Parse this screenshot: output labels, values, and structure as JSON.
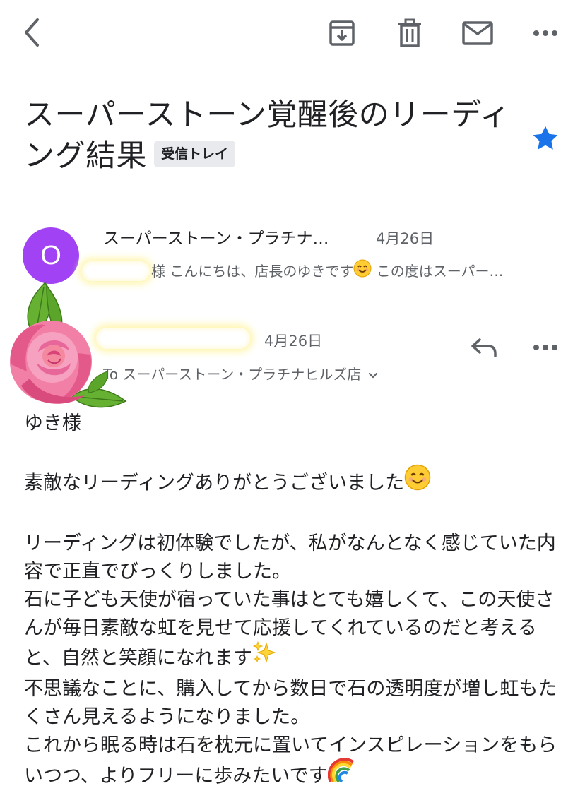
{
  "toolbar": {
    "back_icon": "chevron-left-icon",
    "archive_icon": "archive-icon",
    "delete_icon": "trash-icon",
    "mark_unread_icon": "mail-icon",
    "more_icon": "more-horizontal-icon"
  },
  "subject": {
    "title": "スーパーストーン覚醒後のリーディング結果",
    "label": "受信トレイ",
    "starred": true,
    "star_color": "#1a73e8"
  },
  "messages": [
    {
      "avatar_letter": "O",
      "avatar_color": "#a142f4",
      "sender": "スーパーストーン・プラチナ…",
      "date": "4月26日",
      "snippet_salutation": "様 こんにちは、店長のゆきです",
      "snippet_emoji": "smiling-face-icon",
      "snippet_rest": " この度はスーパー…"
    },
    {
      "date": "4月26日",
      "to_label": "To",
      "to_value": "スーパーストーン・プラチナヒルズ店",
      "reply_icon": "reply-icon",
      "more_icon": "more-horizontal-icon",
      "avatar_sticker": "rose-sticker",
      "body": {
        "greeting": "ゆき様",
        "line_thanks": "素敵なリーディングありがとうございました",
        "p1": "リーディングは初体験でしたが、私がなんとなく感じていた内容で正直でびっくりしました。",
        "p2": "石に子ども天使が宿っていた事はとても嬉しくて、この天使さんが毎日素敵な虹を見せて応援してくれているのだと考えると、自然と笑顔になれます",
        "p3": "不思議なことに、購入してから数日で石の透明度が増し虹もたくさん見えるようになりました。",
        "p4": "これから眠る時は石を枕元に置いてインスピレーションをもらいつつ、よりフリーに歩みたいです"
      }
    }
  ]
}
